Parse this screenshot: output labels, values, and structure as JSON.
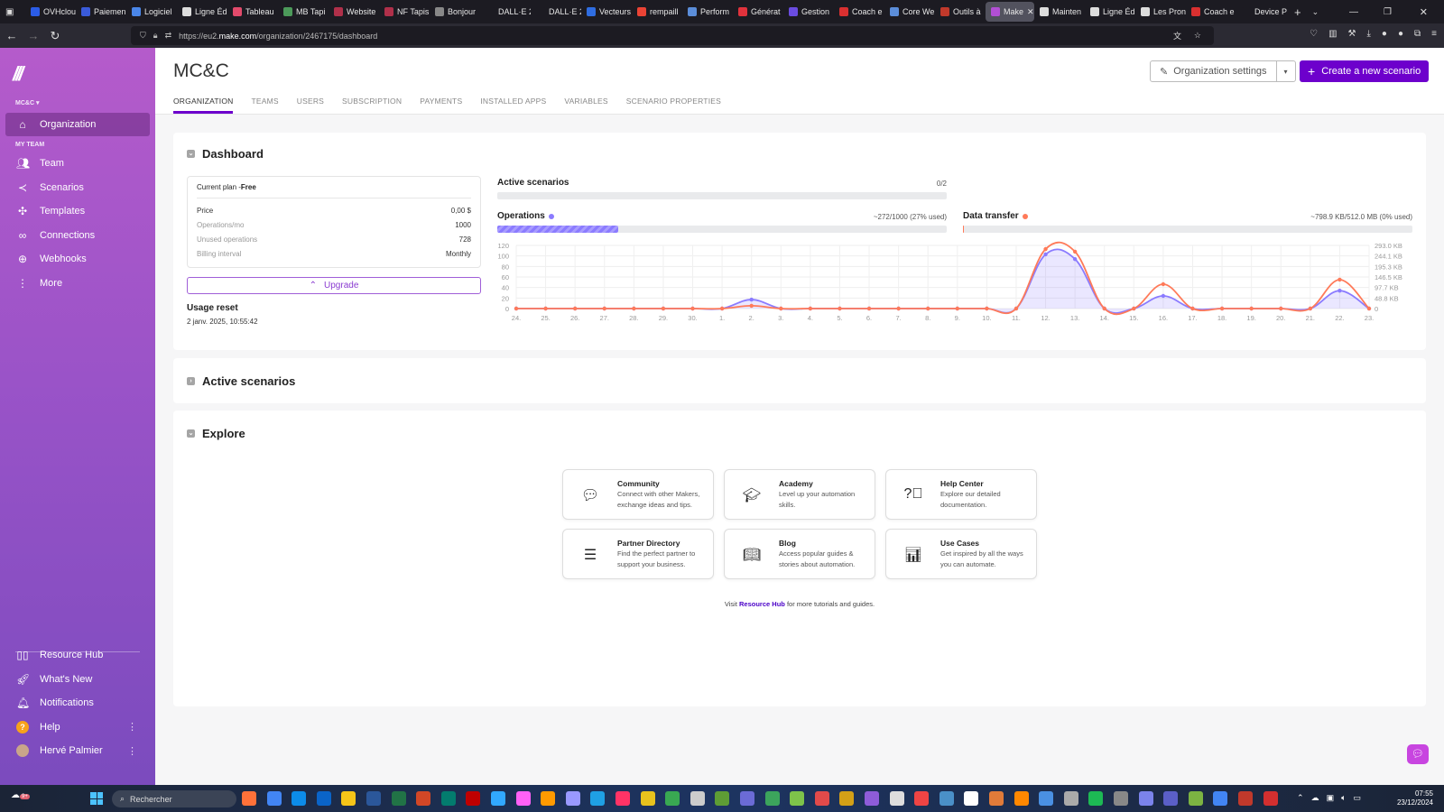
{
  "browser": {
    "tabs": [
      {
        "label": "OVHcloud",
        "color": "#2b5ce6"
      },
      {
        "label": "Paiemen",
        "color": "#3a5bd9"
      },
      {
        "label": "Logiciel",
        "color": "#4a86e8"
      },
      {
        "label": "Ligne Éd",
        "color": "#ddd"
      },
      {
        "label": "Tableau",
        "color": "#e24a6b"
      },
      {
        "label": "MB Tapi",
        "color": "#4c9a5a"
      },
      {
        "label": "Website",
        "color": "#b0304a"
      },
      {
        "label": "NF Tapis",
        "color": "#b0304a"
      },
      {
        "label": "Bonjour",
        "color": "#888"
      },
      {
        "label": "DALL·E 2024",
        "color": "#1c1b22"
      },
      {
        "label": "DALL·E 2024",
        "color": "#1c1b22"
      },
      {
        "label": "Vecteurs",
        "color": "#2f6de1"
      },
      {
        "label": "rempaill",
        "color": "#ea4335"
      },
      {
        "label": "Perform",
        "color": "#5b8dd9"
      },
      {
        "label": "Générat",
        "color": "#e0323c"
      },
      {
        "label": "Gestion",
        "color": "#6a4ce0"
      },
      {
        "label": "Coach e",
        "color": "#d93030"
      },
      {
        "label": "Core We",
        "color": "#5b8dd9"
      },
      {
        "label": "Outils à",
        "color": "#c0392b"
      },
      {
        "label": "Make",
        "color": "#b24fd4",
        "active": true
      },
      {
        "label": "Mainten",
        "color": "#ddd"
      },
      {
        "label": "Ligne Éd",
        "color": "#ddd"
      },
      {
        "label": "Les Pron",
        "color": "#ddd"
      },
      {
        "label": "Coach e",
        "color": "#d93030"
      },
      {
        "label": "Device Previ",
        "color": "#1c1b22"
      }
    ],
    "url_prefix": "https://eu2.",
    "url_domain": "make.com",
    "url_path": "/organization/2467175/dashboard"
  },
  "sidebar": {
    "org_label": "MC&C ▾",
    "section_label": "MY TEAM",
    "org_item": "Organization",
    "items": [
      {
        "label": "Team",
        "icon": "team-icon"
      },
      {
        "label": "Scenarios",
        "icon": "share-icon"
      },
      {
        "label": "Templates",
        "icon": "puzzle-icon"
      },
      {
        "label": "Connections",
        "icon": "link-icon"
      },
      {
        "label": "Webhooks",
        "icon": "globe-icon"
      },
      {
        "label": "More",
        "icon": "kebab-icon"
      }
    ],
    "bottom": [
      {
        "label": "Resource Hub"
      },
      {
        "label": "What's New"
      },
      {
        "label": "Notifications"
      },
      {
        "label": "Help"
      },
      {
        "label": "Hervé Palmier"
      }
    ]
  },
  "header": {
    "title": "MC&C",
    "tabs": [
      "ORGANIZATION",
      "TEAMS",
      "USERS",
      "SUBSCRIPTION",
      "PAYMENTS",
      "INSTALLED APPS",
      "VARIABLES",
      "SCENARIO PROPERTIES"
    ],
    "org_settings": "Organization settings",
    "create": "Create a new scenario",
    "accent": "#6d00cc"
  },
  "dashboard": {
    "title": "Dashboard",
    "plan": {
      "label": "Current plan - ",
      "name": "Free",
      "rows": [
        {
          "k": "Price",
          "v": "0,00 $"
        },
        {
          "k": "Operations/mo",
          "v": "1000"
        },
        {
          "k": "Unused operations",
          "v": "728"
        },
        {
          "k": "Billing interval",
          "v": "Monthly"
        }
      ]
    },
    "upgrade": "Upgrade",
    "usage_reset_label": "Usage reset",
    "usage_reset_value": "2 janv. 2025, 10:55:42",
    "active_scenarios": {
      "label": "Active scenarios",
      "value": "0/2",
      "fraction": 0
    },
    "operations": {
      "label": "Operations",
      "value": "~272/1000 (27% used)",
      "fraction": 0.27,
      "color": "#8b7bff"
    },
    "data_transfer": {
      "label": "Data transfer",
      "value": "~798.9 KB/512.0 MB (0% used)",
      "fraction": 0.0015,
      "color": "#ff7a59"
    }
  },
  "chart_data": {
    "type": "line",
    "categories": [
      "24.",
      "25.",
      "26.",
      "27.",
      "28.",
      "29.",
      "30.",
      "1.",
      "2.",
      "3.",
      "4.",
      "5.",
      "6.",
      "7.",
      "8.",
      "9.",
      "10.",
      "11.",
      "12.",
      "13.",
      "14.",
      "15.",
      "16.",
      "17.",
      "18.",
      "19.",
      "20.",
      "21.",
      "22.",
      "23."
    ],
    "series": [
      {
        "name": "Operations",
        "axis": "left",
        "color": "#8b7bff",
        "values": [
          0,
          0,
          0,
          0,
          0,
          0,
          0,
          0,
          17,
          0,
          0,
          0,
          0,
          0,
          0,
          0,
          0,
          0,
          103,
          94,
          0,
          0,
          24,
          0,
          0,
          0,
          0,
          0,
          34,
          0
        ]
      },
      {
        "name": "Data transfer",
        "axis": "right",
        "unit": "KB",
        "color": "#ff7a59",
        "values": [
          0,
          0,
          0,
          0,
          0,
          0,
          0,
          0,
          13,
          0,
          0,
          0,
          0,
          0,
          0,
          0,
          0,
          0,
          276,
          264,
          0,
          0,
          113,
          0,
          0,
          0,
          0,
          0,
          134,
          0
        ]
      }
    ],
    "left_ticks": [
      "0",
      "20",
      "40",
      "60",
      "80",
      "100",
      "120"
    ],
    "right_ticks": [
      "0",
      "48.8 KB",
      "97.7 KB",
      "146.5 KB",
      "195.3 KB",
      "244.1 KB",
      "293.0 KB"
    ],
    "ylim_left": [
      0,
      120
    ],
    "ylim_right": [
      0,
      293
    ],
    "grid": true
  },
  "active_section": {
    "title": "Active scenarios"
  },
  "explore": {
    "title": "Explore",
    "cards": [
      {
        "title": "Community",
        "desc": "Connect with other Makers, exchange ideas and tips.",
        "icon": "chat-icon"
      },
      {
        "title": "Academy",
        "desc": "Level up your automation skills.",
        "icon": "graduation-cap-icon"
      },
      {
        "title": "Help Center",
        "desc": "Explore our detailed documentation.",
        "icon": "question-icon"
      },
      {
        "title": "Partner Directory",
        "desc": "Find the perfect partner to support your business.",
        "icon": "list-icon"
      },
      {
        "title": "Blog",
        "desc": "Access popular guides & stories about automation.",
        "icon": "book-icon"
      },
      {
        "title": "Use Cases",
        "desc": "Get inspired by all the ways you can automate.",
        "icon": "bar-chart-icon"
      }
    ],
    "visit_pre": "Visit ",
    "visit_link": "Resource Hub",
    "visit_post": " for more tutorials and guides."
  },
  "taskbar": {
    "search": "Rechercher",
    "notif_badge": "9+",
    "time": "07:55",
    "date": "23/12/2024",
    "apps": [
      "#ff7139",
      "#4285f4",
      "#0c8ce9",
      "#0a64c8",
      "#f5c518",
      "#2b579a",
      "#217346",
      "#d24726",
      "#037c6e",
      "#bf0000",
      "#31a8ff",
      "#ff61f6",
      "#ff9a00",
      "#9999ff",
      "#1fa0e4",
      "#ff3366",
      "#e8c21d",
      "#39a852",
      "#ccc",
      "#5e9d35",
      "#6b6bd6",
      "#3ca45c",
      "#7ec34a",
      "#e24a4a",
      "#d4a017",
      "#8e5cd9",
      "#ddd",
      "#e44",
      "#4a90c8",
      "#fff",
      "#e07b39",
      "#ff8800",
      "#4a90e2",
      "#aaa",
      "#1db954",
      "#888",
      "#7b83eb",
      "#5b5fc7",
      "#7cb342",
      "#4285f4",
      "#c0392b",
      "#d32f2f"
    ]
  }
}
